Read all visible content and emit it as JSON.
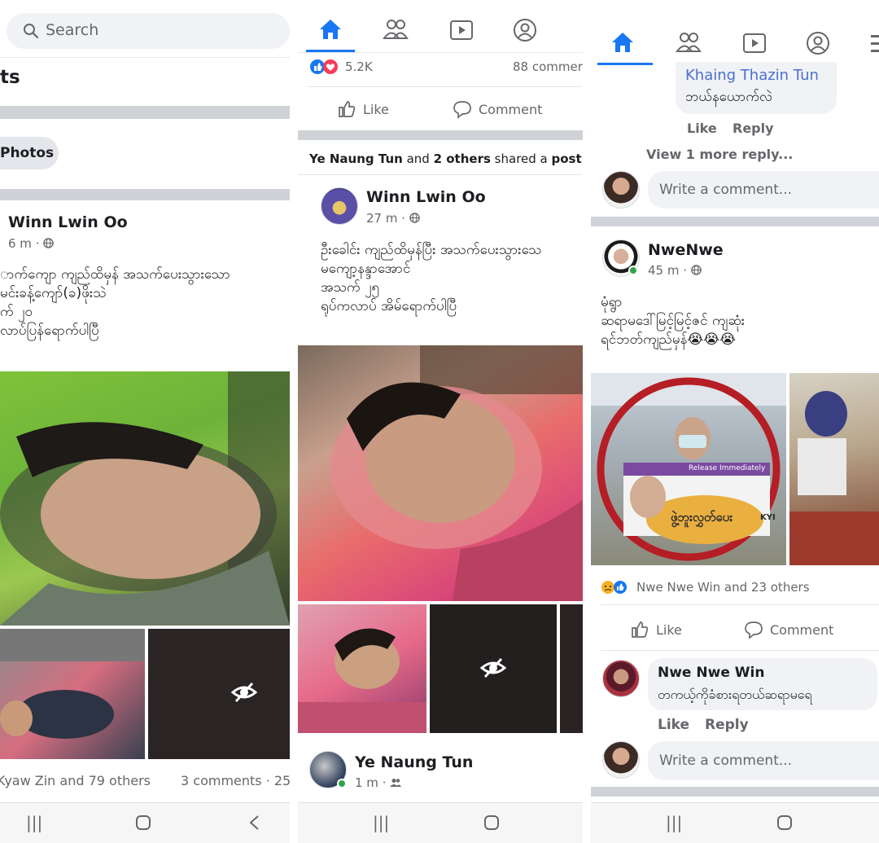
{
  "panel1": {
    "search_placeholder": "Search",
    "section_title": "ts",
    "photos_chip": "Photos",
    "post": {
      "author": "Winn Lwin Oo",
      "time": "6 m",
      "lines": [
        "ာက်ကျော ကျည်ထိမှန် အသက်ပေးသွားသော",
        "မင်းခန့်ကျော်(ခ)ဖိုးသဲ",
        "က် ၂၀",
        "လာပ်ပြန်ရောက်ပါပြီ"
      ],
      "reactions": "Kyaw Zin and 79 others",
      "comments": "3 comments · 25"
    }
  },
  "panel2": {
    "reaction_count": "5.2K",
    "comments_count": "88 commer",
    "like_label": "Like",
    "comment_label": "Comment",
    "shared_line": {
      "name": "Ye Naung Tun",
      "mid": " and ",
      "others": "2 others",
      "rest": " shared a ",
      "post": "post",
      "end": "."
    },
    "post": {
      "author": "Winn Lwin Oo",
      "time": "27 m",
      "lines": [
        "ဦးခေါင်း ကျည်ထိမှန်ပြီး အသက်ပေးသွားသေ",
        "မကျော့နန္ဒာအောင်",
        "အသက် ၂၅",
        "ရုပ်ကလာပ် အိမ်ရောက်ပါပြီ"
      ]
    },
    "next_post": {
      "author": "Ye Naung Tun",
      "time": "1 m"
    }
  },
  "panel3": {
    "reply_author": "Khaing Thazin Tun",
    "reply_text": "ဘယ်နယောက်လဲ",
    "like_label": "Like",
    "reply_label": "Reply",
    "view_more": "View 1 more reply...",
    "write_comment": "Write a comment...",
    "post": {
      "author": "NweNwe",
      "time": "45 m",
      "lines": [
        "မုံရွာ",
        "ဆရာမဒေါ်မြင့်မြင့်ဇင် ကျဆုံး",
        "ရင်ဘတ်ကျည်မှန်😭😭😭"
      ],
      "photo_sign": "ဖွဲ့ဘူးလွှတ်ပေး",
      "photo_sign_suffix": "KYI",
      "photo_banner": "Release Immediately",
      "reactions": "Nwe Nwe Win and 23 others",
      "like_label": "Like",
      "comment_label": "Comment"
    },
    "comment": {
      "author": "Nwe Nwe Win",
      "text": "တကယ့်ကိုခံစားရတယ်ဆရာမရေ",
      "like_label": "Like",
      "reply_label": "Reply"
    },
    "write_comment2": "Write a comment..."
  },
  "colors": {
    "fb_blue": "#1877f2",
    "divider": "#cfd2d6",
    "text_secondary": "#65676b"
  },
  "icons": [
    "search-icon",
    "home-icon",
    "friends-icon",
    "watch-icon",
    "profile-icon",
    "like-icon",
    "comment-icon",
    "globe-icon",
    "hidden-eye-icon",
    "love-reaction-icon",
    "sad-reaction-icon"
  ]
}
